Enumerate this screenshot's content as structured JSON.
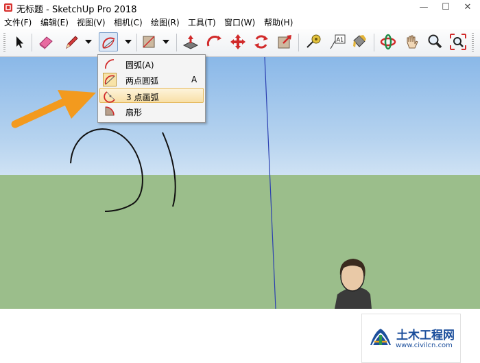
{
  "window": {
    "title": "无标题 - SketchUp Pro 2018",
    "minimize_glyph": "—",
    "maximize_glyph": "☐",
    "close_glyph": "✕"
  },
  "menubar": {
    "items": [
      {
        "label": "文件(F)"
      },
      {
        "label": "编辑(E)"
      },
      {
        "label": "视图(V)"
      },
      {
        "label": "相机(C)"
      },
      {
        "label": "绘图(R)"
      },
      {
        "label": "工具(T)"
      },
      {
        "label": "窗口(W)"
      },
      {
        "label": "帮助(H)"
      }
    ]
  },
  "toolbar": {
    "buttons": [
      {
        "icon": "select-arrow-icon"
      },
      {
        "icon": "eraser-icon"
      },
      {
        "icon": "pencil-line-icon"
      },
      {
        "icon": "arc-icon"
      },
      {
        "icon": "rectangle-icon"
      },
      {
        "icon": "push-pull-icon"
      },
      {
        "icon": "follow-me-icon"
      },
      {
        "icon": "move-icon"
      },
      {
        "icon": "rotate-icon"
      },
      {
        "icon": "offset-icon"
      },
      {
        "icon": "tape-measure-icon"
      },
      {
        "icon": "text-icon",
        "text": "A1"
      },
      {
        "icon": "paint-bucket-icon"
      },
      {
        "icon": "orbit-icon"
      },
      {
        "icon": "pan-hand-icon"
      },
      {
        "icon": "zoom-icon"
      },
      {
        "icon": "zoom-extents-icon"
      }
    ]
  },
  "arc_menu": {
    "items": [
      {
        "label": "圆弧(A)",
        "shortcut": "",
        "icon": "arc-icon"
      },
      {
        "label": "两点圆弧",
        "shortcut": "A",
        "icon": "two-point-arc-icon"
      },
      {
        "label": "3 点画弧",
        "shortcut": "",
        "icon": "three-point-arc-icon",
        "highlighted": true
      },
      {
        "label": "扇形",
        "shortcut": "",
        "icon": "pie-icon"
      }
    ]
  },
  "colors": {
    "sky_top": "#8ab8e8",
    "ground": "#9bbe8b",
    "arrow": "#f39a1e",
    "menu_highlight": "#f8dfa6",
    "watermark_text": "#1c4f9c"
  },
  "watermark": {
    "name": "土木工程网",
    "url": "www.civilcn.com"
  }
}
